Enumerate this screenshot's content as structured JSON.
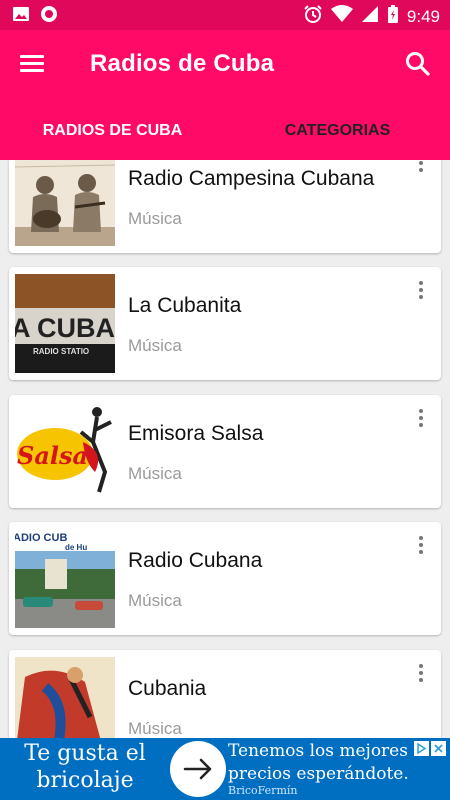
{
  "status_bar": {
    "time": "9:49",
    "left_icons": [
      "image-icon",
      "record-icon"
    ],
    "right_icons": [
      "alarm-icon",
      "wifi-icon",
      "signal-icon",
      "battery-icon"
    ]
  },
  "app_bar": {
    "title": "Radios de Cuba",
    "menu_icon": "hamburger-menu-icon",
    "search_icon": "search-icon",
    "color": "#ff0a66"
  },
  "tabs": [
    {
      "label": "RADIOS DE CUBA",
      "active": true
    },
    {
      "label": "CATEGORIAS",
      "active": false
    }
  ],
  "stations": [
    {
      "name": "Radio Campesina Cubana",
      "category": "Música"
    },
    {
      "name": "La Cubanita",
      "category": "Música"
    },
    {
      "name": "Emisora Salsa",
      "category": "Música"
    },
    {
      "name": "Radio Cubana",
      "category": "Música"
    },
    {
      "name": "Cubania",
      "category": "Música"
    }
  ],
  "thumb_text": {
    "cubanita_main": "A CUBANIT",
    "cubanita_sub": "RADIO STATIO",
    "salsa": "Salsa",
    "radio_cubana_top": "ADIO CUB",
    "radio_cubana_sub": "de Hu"
  },
  "ad": {
    "left_text": "Te gusta el bricolaje",
    "right_text": "Tenemos los mejores precios esperándote.",
    "brand": "BricoFermín",
    "color": "#006fc2"
  }
}
